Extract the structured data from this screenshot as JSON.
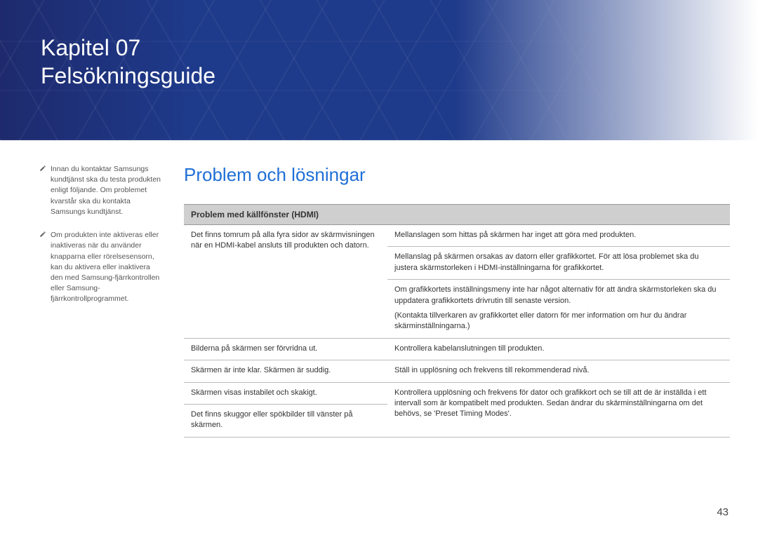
{
  "banner": {
    "line1": "Kapitel 07",
    "line2": "Felsökningsguide"
  },
  "sidebar": {
    "notes": [
      "Innan du kontaktar Samsungs kundtjänst ska du testa produkten enligt följande. Om problemet kvarstår ska du kontakta Samsungs kundtjänst.",
      "Om produkten inte aktiveras eller inaktiveras när du använder knapparna eller rörelsesensorn, kan du aktivera eller inaktivera den med Samsung-fjärrkontrollen eller Samsung-fjärrkontrollprogrammet."
    ]
  },
  "main": {
    "section_title": "Problem och lösningar",
    "table": {
      "header": "Problem med källfönster (HDMI)",
      "rows": [
        {
          "problem": "Det finns tomrum på alla fyra sidor av skärmvisningen när en HDMI-kabel ansluts till produkten och datorn.",
          "solutions": [
            "Mellanslagen som hittas på skärmen har inget att göra med produkten.",
            "Mellanslag på skärmen orsakas av datorn eller grafikkortet. För att lösa problemet ska du justera skärmstorleken i HDMI-inställningarna för grafikkortet.",
            "Om grafikkortets inställningsmeny inte har något alternativ för att ändra skärmstorleken ska du uppdatera grafikkortets drivrutin till senaste version.",
            "(Kontakta tillverkaren av grafikkortet eller datorn för mer information om hur du ändrar skärminställningarna.)"
          ]
        },
        {
          "problem": "Bilderna på skärmen ser förvridna ut.",
          "solutions": [
            "Kontrollera kabelanslutningen till produkten."
          ]
        },
        {
          "problem": "Skärmen är inte klar. Skärmen är suddig.",
          "solutions": [
            "Ställ in upplösning och frekvens till rekommenderad nivå."
          ]
        },
        {
          "problem": "Skärmen visas instabilet och skakigt.",
          "solutions": [
            "Kontrollera upplösning och frekvens för dator och grafikkort och se till att de är inställda i ett intervall som är kompatibelt med produkten. Sedan ändrar du skärminställningarna om det behövs, se 'Preset Timing Modes'."
          ]
        },
        {
          "problem": "Det finns skuggor eller spökbilder till vänster på skärmen.",
          "solutions": []
        }
      ]
    }
  },
  "page_number": "43"
}
